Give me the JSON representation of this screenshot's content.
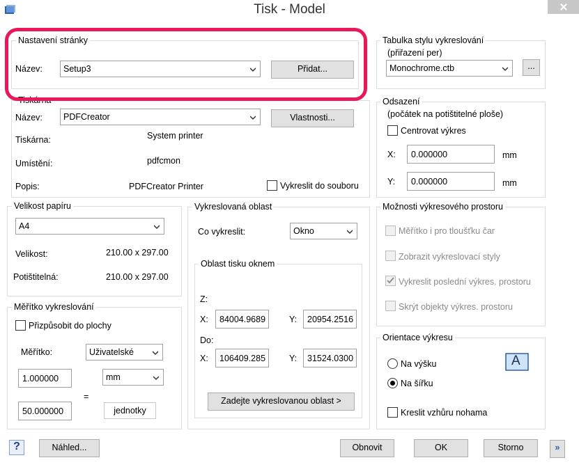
{
  "window": {
    "title": "Tisk -   Model"
  },
  "page_setup": {
    "group": "Nastavení stránky",
    "name_label": "Název:",
    "name_value": "Setup3",
    "add_button": "Přidat..."
  },
  "printer": {
    "group": "Tiskárna",
    "name_label": "Název:",
    "name_value": "PDFCreator",
    "properties_button": "Vlastnosti...",
    "printer_label": "Tiskárna:",
    "printer_value": "System printer",
    "location_label": "Umístění:",
    "location_value": "pdfcmon",
    "desc_label": "Popis:",
    "desc_value": "PDFCreator Printer",
    "plot_to_file": "Vykreslit do souboru"
  },
  "style_table": {
    "group": "Tabulka stylu vykreslování",
    "sub": "(přiřazení per)",
    "value": "Monochrome.ctb",
    "browse": "..."
  },
  "offset": {
    "group": "Odsazení",
    "sub": "(počátek na potištitelné ploše)",
    "center": "Centrovat výkres",
    "x_label": "X:",
    "x_value": "0.000000",
    "x_unit": "mm",
    "y_label": "Y:",
    "y_value": "0.000000",
    "y_unit": "mm"
  },
  "paper": {
    "group": "Velikost papíru",
    "value": "A4",
    "size_label": "Velikost:",
    "size_value": "210.00 x 297.00",
    "printable_label": "Potištitelná:",
    "printable_value": "210.00 x 297.00"
  },
  "area": {
    "group": "Vykreslovaná oblast",
    "what_label": "Co vykreslit:",
    "what_value": "Okno",
    "window_group": "Oblast tisku oknem",
    "from_label": "Z:",
    "x1_label": "X:",
    "x1": "84004.9689",
    "y1_label": "Y:",
    "y1": "20954.2516",
    "to_label": "Do:",
    "x2_label": "X:",
    "x2": "106409.285",
    "y2_label": "Y:",
    "y2": "31524.0300",
    "enter_button": "Zadejte vykreslovanou oblast >"
  },
  "options": {
    "group": "Možnosti výkresového prostoru",
    "lineweights": "Měřítko i pro tloušťku čar",
    "styles": "Zobrazit vykreslovací styly",
    "last": "Vykreslit poslední výkres. prostoru",
    "hide": "Skrýt objekty výkres. prostoru"
  },
  "scale": {
    "group": "Měřítko vykreslování",
    "fit": "Přizpůsobit do plochy",
    "scale_label": "Měřítko:",
    "scale_value": "Uživatelské",
    "v1": "1.000000",
    "unit": "mm",
    "equals": "=",
    "v2": "50.000000",
    "units": "jednotky"
  },
  "orientation": {
    "group": "Orientace výkresu",
    "portrait": "Na výšku",
    "landscape": "Na šířku",
    "upside": "Kreslit vzhůru nohama",
    "icon_letter": "A"
  },
  "footer": {
    "help": "?",
    "preview": "Náhled...",
    "reset": "Obnovit",
    "ok": "OK",
    "cancel": "Storno",
    "more": "»"
  }
}
